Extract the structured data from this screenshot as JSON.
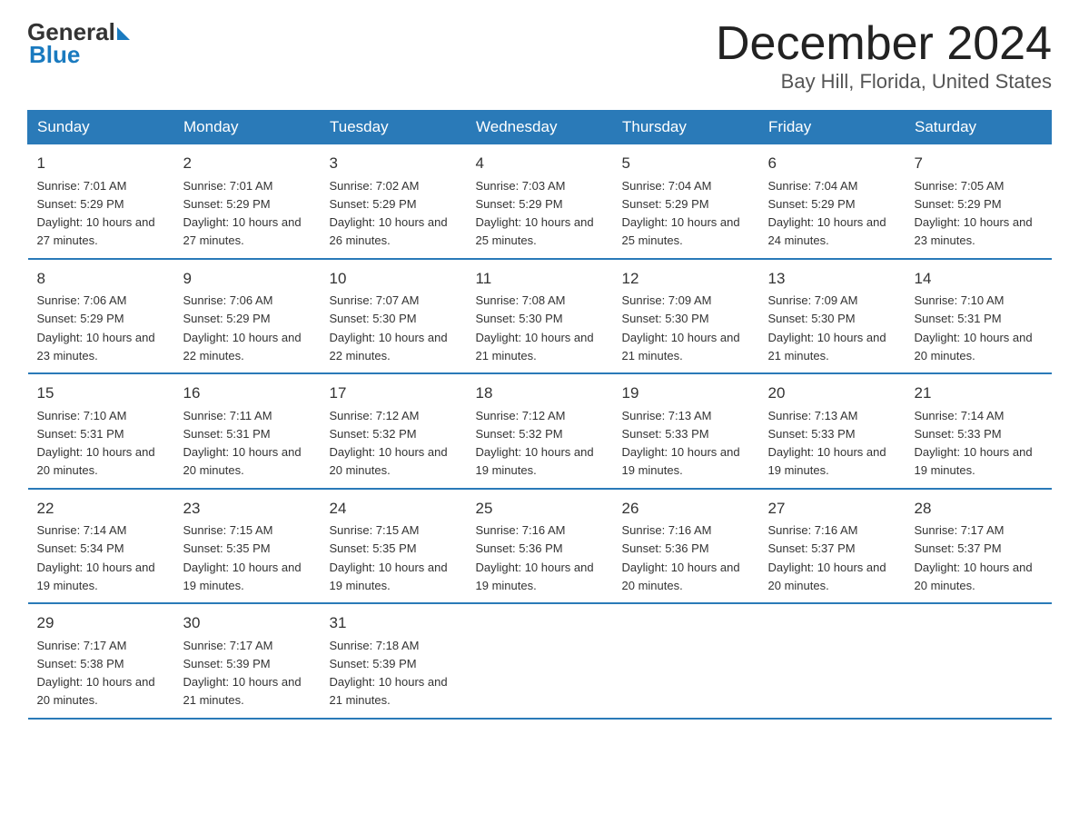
{
  "logo": {
    "text_general": "General",
    "text_blue": "Blue"
  },
  "header": {
    "month": "December 2024",
    "location": "Bay Hill, Florida, United States"
  },
  "days_of_week": [
    "Sunday",
    "Monday",
    "Tuesday",
    "Wednesday",
    "Thursday",
    "Friday",
    "Saturday"
  ],
  "weeks": [
    [
      {
        "day": "1",
        "sunrise": "7:01 AM",
        "sunset": "5:29 PM",
        "daylight": "10 hours and 27 minutes."
      },
      {
        "day": "2",
        "sunrise": "7:01 AM",
        "sunset": "5:29 PM",
        "daylight": "10 hours and 27 minutes."
      },
      {
        "day": "3",
        "sunrise": "7:02 AM",
        "sunset": "5:29 PM",
        "daylight": "10 hours and 26 minutes."
      },
      {
        "day": "4",
        "sunrise": "7:03 AM",
        "sunset": "5:29 PM",
        "daylight": "10 hours and 25 minutes."
      },
      {
        "day": "5",
        "sunrise": "7:04 AM",
        "sunset": "5:29 PM",
        "daylight": "10 hours and 25 minutes."
      },
      {
        "day": "6",
        "sunrise": "7:04 AM",
        "sunset": "5:29 PM",
        "daylight": "10 hours and 24 minutes."
      },
      {
        "day": "7",
        "sunrise": "7:05 AM",
        "sunset": "5:29 PM",
        "daylight": "10 hours and 23 minutes."
      }
    ],
    [
      {
        "day": "8",
        "sunrise": "7:06 AM",
        "sunset": "5:29 PM",
        "daylight": "10 hours and 23 minutes."
      },
      {
        "day": "9",
        "sunrise": "7:06 AM",
        "sunset": "5:29 PM",
        "daylight": "10 hours and 22 minutes."
      },
      {
        "day": "10",
        "sunrise": "7:07 AM",
        "sunset": "5:30 PM",
        "daylight": "10 hours and 22 minutes."
      },
      {
        "day": "11",
        "sunrise": "7:08 AM",
        "sunset": "5:30 PM",
        "daylight": "10 hours and 21 minutes."
      },
      {
        "day": "12",
        "sunrise": "7:09 AM",
        "sunset": "5:30 PM",
        "daylight": "10 hours and 21 minutes."
      },
      {
        "day": "13",
        "sunrise": "7:09 AM",
        "sunset": "5:30 PM",
        "daylight": "10 hours and 21 minutes."
      },
      {
        "day": "14",
        "sunrise": "7:10 AM",
        "sunset": "5:31 PM",
        "daylight": "10 hours and 20 minutes."
      }
    ],
    [
      {
        "day": "15",
        "sunrise": "7:10 AM",
        "sunset": "5:31 PM",
        "daylight": "10 hours and 20 minutes."
      },
      {
        "day": "16",
        "sunrise": "7:11 AM",
        "sunset": "5:31 PM",
        "daylight": "10 hours and 20 minutes."
      },
      {
        "day": "17",
        "sunrise": "7:12 AM",
        "sunset": "5:32 PM",
        "daylight": "10 hours and 20 minutes."
      },
      {
        "day": "18",
        "sunrise": "7:12 AM",
        "sunset": "5:32 PM",
        "daylight": "10 hours and 19 minutes."
      },
      {
        "day": "19",
        "sunrise": "7:13 AM",
        "sunset": "5:33 PM",
        "daylight": "10 hours and 19 minutes."
      },
      {
        "day": "20",
        "sunrise": "7:13 AM",
        "sunset": "5:33 PM",
        "daylight": "10 hours and 19 minutes."
      },
      {
        "day": "21",
        "sunrise": "7:14 AM",
        "sunset": "5:33 PM",
        "daylight": "10 hours and 19 minutes."
      }
    ],
    [
      {
        "day": "22",
        "sunrise": "7:14 AM",
        "sunset": "5:34 PM",
        "daylight": "10 hours and 19 minutes."
      },
      {
        "day": "23",
        "sunrise": "7:15 AM",
        "sunset": "5:35 PM",
        "daylight": "10 hours and 19 minutes."
      },
      {
        "day": "24",
        "sunrise": "7:15 AM",
        "sunset": "5:35 PM",
        "daylight": "10 hours and 19 minutes."
      },
      {
        "day": "25",
        "sunrise": "7:16 AM",
        "sunset": "5:36 PM",
        "daylight": "10 hours and 19 minutes."
      },
      {
        "day": "26",
        "sunrise": "7:16 AM",
        "sunset": "5:36 PM",
        "daylight": "10 hours and 20 minutes."
      },
      {
        "day": "27",
        "sunrise": "7:16 AM",
        "sunset": "5:37 PM",
        "daylight": "10 hours and 20 minutes."
      },
      {
        "day": "28",
        "sunrise": "7:17 AM",
        "sunset": "5:37 PM",
        "daylight": "10 hours and 20 minutes."
      }
    ],
    [
      {
        "day": "29",
        "sunrise": "7:17 AM",
        "sunset": "5:38 PM",
        "daylight": "10 hours and 20 minutes."
      },
      {
        "day": "30",
        "sunrise": "7:17 AM",
        "sunset": "5:39 PM",
        "daylight": "10 hours and 21 minutes."
      },
      {
        "day": "31",
        "sunrise": "7:18 AM",
        "sunset": "5:39 PM",
        "daylight": "10 hours and 21 minutes."
      },
      null,
      null,
      null,
      null
    ]
  ]
}
